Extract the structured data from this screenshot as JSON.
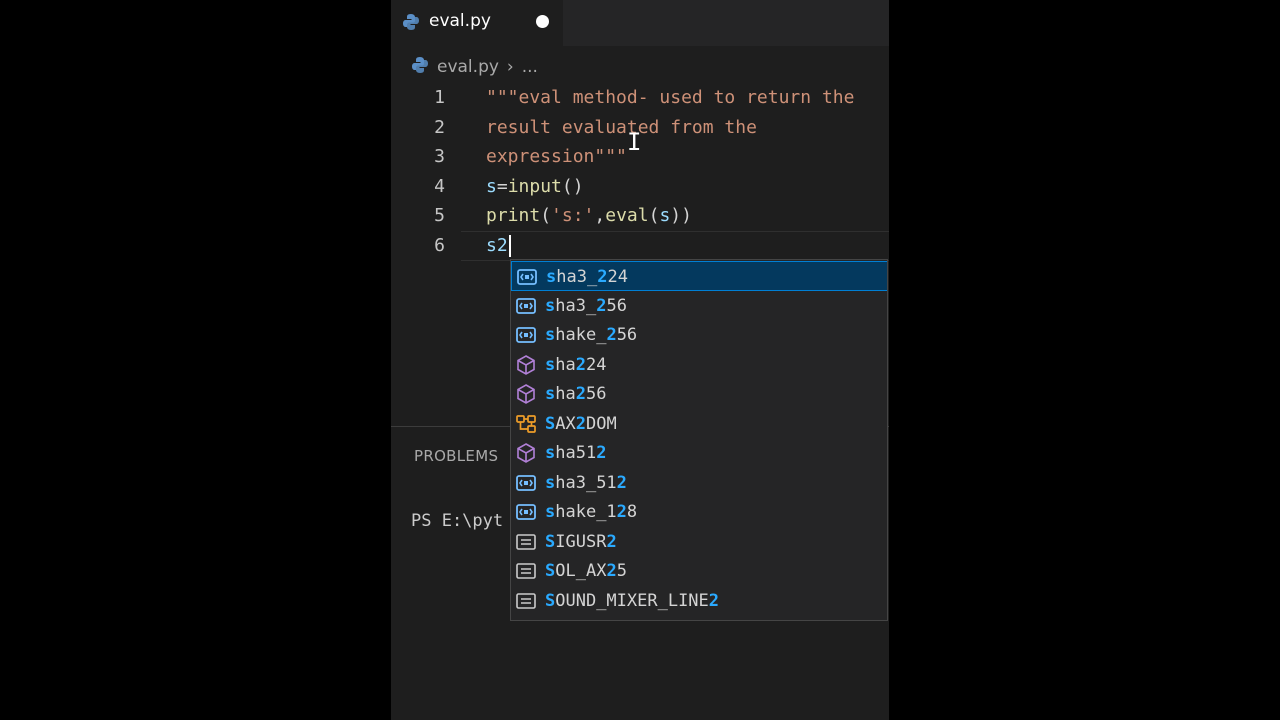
{
  "tab": {
    "filename": "eval.py"
  },
  "breadcrumb": {
    "file": "eval.py",
    "separator": "›",
    "more": "..."
  },
  "editor": {
    "lines": [
      {
        "num": "1",
        "parts": [
          {
            "text": "\"\"\"eval method- used to return the",
            "cls": "str"
          }
        ]
      },
      {
        "num": "2",
        "parts": [
          {
            "text": "result evaluated from the",
            "cls": "str"
          }
        ]
      },
      {
        "num": "3",
        "parts": [
          {
            "text": "expression\"\"\"",
            "cls": "str"
          }
        ]
      },
      {
        "num": "4",
        "parts": [
          {
            "text": "s",
            "cls": "var"
          },
          {
            "text": "=",
            "cls": ""
          },
          {
            "text": "input",
            "cls": "fn"
          },
          {
            "text": "()",
            "cls": ""
          }
        ]
      },
      {
        "num": "5",
        "parts": [
          {
            "text": "print",
            "cls": "fn"
          },
          {
            "text": "(",
            "cls": ""
          },
          {
            "text": "'s:'",
            "cls": "str"
          },
          {
            "text": ",",
            "cls": ""
          },
          {
            "text": "eval",
            "cls": "fn"
          },
          {
            "text": "(",
            "cls": ""
          },
          {
            "text": "s",
            "cls": "var"
          },
          {
            "text": "))",
            "cls": ""
          }
        ]
      },
      {
        "num": "6",
        "parts": [
          {
            "text": "s2",
            "cls": "var"
          }
        ],
        "current": true
      }
    ]
  },
  "panel": {
    "tab_label": "PROBLEMS",
    "terminal_text": "PS E:\\pyt"
  },
  "suggestions": [
    {
      "pre": "s",
      "m1": "",
      "mid": "ha3_",
      "m2": "2",
      "post": "24",
      "kind": "variable",
      "selected": true
    },
    {
      "pre": "s",
      "m1": "",
      "mid": "ha3_",
      "m2": "2",
      "post": "56",
      "kind": "variable"
    },
    {
      "pre": "s",
      "m1": "",
      "mid": "hake_",
      "m2": "2",
      "post": "56",
      "kind": "variable"
    },
    {
      "pre": "s",
      "m1": "",
      "mid": "ha",
      "m2": "2",
      "post": "24",
      "kind": "module"
    },
    {
      "pre": "s",
      "m1": "",
      "mid": "ha",
      "m2": "2",
      "post": "56",
      "kind": "module"
    },
    {
      "pre": "S",
      "m1": "",
      "mid": "AX",
      "m2": "2",
      "post": "DOM",
      "kind": "class"
    },
    {
      "pre": "s",
      "m1": "",
      "mid": "ha51",
      "m2": "2",
      "post": "",
      "kind": "module"
    },
    {
      "pre": "s",
      "m1": "",
      "mid": "ha3_51",
      "m2": "2",
      "post": "",
      "kind": "variable"
    },
    {
      "pre": "s",
      "m1": "",
      "mid": "hake_1",
      "m2": "2",
      "post": "8",
      "kind": "variable"
    },
    {
      "pre": "S",
      "m1": "",
      "mid": "IGUSR",
      "m2": "2",
      "post": "",
      "kind": "constant"
    },
    {
      "pre": "S",
      "m1": "",
      "mid": "OL_AX",
      "m2": "2",
      "post": "5",
      "kind": "constant"
    },
    {
      "pre": "S",
      "m1": "",
      "mid": "OUND_MIXER_LINE",
      "m2": "2",
      "post": "",
      "kind": "constant"
    }
  ],
  "colors": {
    "editor_bg": "#1e1e1e",
    "selection_bg": "#04395e",
    "match_highlight": "#2aaaff",
    "string": "#ce9178",
    "function": "#dcdcaa"
  }
}
